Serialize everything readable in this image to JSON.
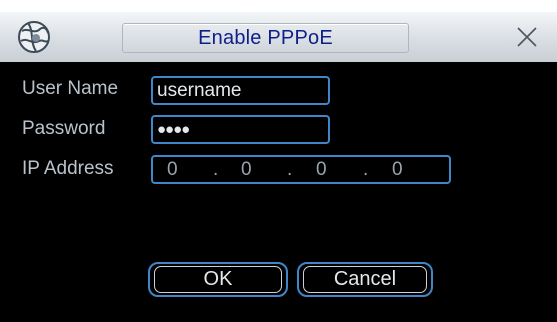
{
  "dialog": {
    "title": "Enable PPPoE",
    "app_icon": "globe-icon",
    "close_icon": "close-icon"
  },
  "form": {
    "username": {
      "label": "User Name",
      "value": "username"
    },
    "password": {
      "label": "Password",
      "value": "●●●●"
    },
    "ip_address": {
      "label": "IP Address",
      "octets": [
        "0",
        "0",
        "0",
        "0"
      ],
      "separator": "."
    }
  },
  "buttons": {
    "ok": "OK",
    "cancel": "Cancel"
  },
  "colors": {
    "title_text": "#0d1f8a",
    "field_border": "#3f87c8",
    "label_text": "#b9c3cc",
    "background": "#000000"
  }
}
